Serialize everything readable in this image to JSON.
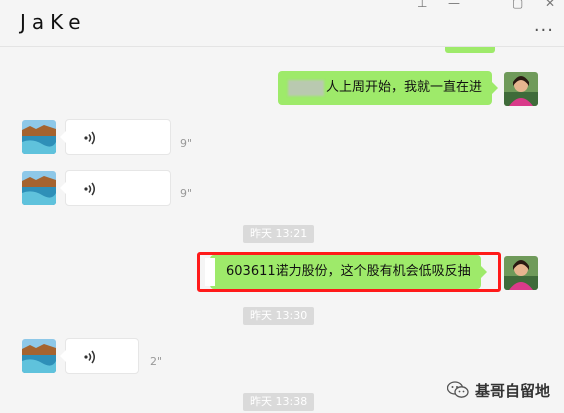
{
  "window": {
    "title": "JaKe",
    "controls": [
      "pin-icon",
      "minimize-icon",
      "maximize-icon",
      "close-icon"
    ],
    "more_label": "···"
  },
  "messages": {
    "m1_text": "人上周开始，我就一直在进",
    "voice1_duration": "9\"",
    "voice2_duration": "9\"",
    "time1": "昨天 13:21",
    "m2_text": "603611诺力股份，这个股有机会低吸反抽",
    "time2": "昨天 13:30",
    "voice3_duration": "2\"",
    "time3": "昨天 13:38"
  },
  "watermark": {
    "text": "基哥自留地",
    "icon": "wechat-icon"
  },
  "colors": {
    "bubble_green": "#9eea6a",
    "highlight_red": "#ff1a1a",
    "background": "#f5f5f5"
  }
}
